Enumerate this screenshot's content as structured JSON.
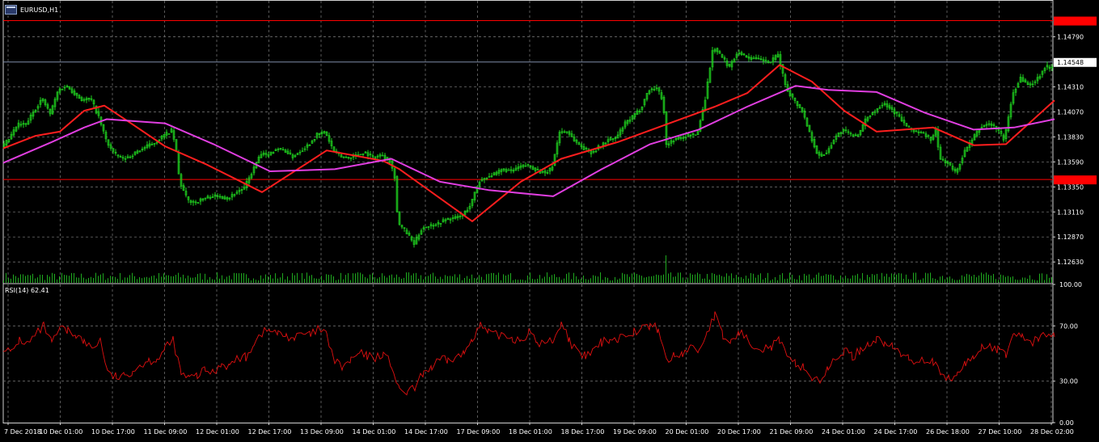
{
  "window": {
    "symbol_title": "EURUSD,H1"
  },
  "colors": {
    "background": "#000000",
    "grid": "#6e6e6e",
    "candle": "#1fd11f",
    "ma_fast": "#ff1e1e",
    "ma_slow": "#e03ee0",
    "level_line": "#ff0000",
    "bid_line": "#7d8aa5",
    "rsi": "#e01010",
    "volume": "#1fa81f"
  },
  "chart_data": [
    {
      "type": "line",
      "name": "price",
      "ylim": [
        1.1243,
        1.1505
      ],
      "y_ticks": [
        "1.14790",
        "1.14310",
        "1.14070",
        "1.13830",
        "1.13590",
        "1.13350",
        "1.13110",
        "1.12870",
        "1.12630"
      ],
      "price_badges": [
        {
          "label": "1.14548",
          "value": 1.14548,
          "style": "bid"
        }
      ],
      "levels": [
        {
          "value": 1.14945,
          "label": ""
        },
        {
          "value": 1.13421,
          "label": ""
        }
      ],
      "x_labels": [
        "7 Dec 2018",
        "10 Dec 01:00",
        "10 Dec 17:00",
        "11 Dec 09:00",
        "12 Dec 01:00",
        "12 Dec 17:00",
        "13 Dec 09:00",
        "14 Dec 01:00",
        "14 Dec 17:00",
        "17 Dec 09:00",
        "18 Dec 01:00",
        "18 Dec 17:00",
        "19 Dec 09:00",
        "20 Dec 01:00",
        "20 Dec 17:00",
        "21 Dec 09:00",
        "24 Dec 01:00",
        "24 Dec 17:00",
        "26 Dec 18:00",
        "27 Dec 10:00",
        "28 Dec 02:00"
      ],
      "closes": [
        [
          0,
          1.1372
        ],
        [
          10,
          1.1382
        ],
        [
          20,
          1.1395
        ],
        [
          30,
          1.1395
        ],
        [
          40,
          1.1408
        ],
        [
          50,
          1.142
        ],
        [
          60,
          1.1405
        ],
        [
          70,
          1.1428
        ],
        [
          80,
          1.1432
        ],
        [
          90,
          1.1425
        ],
        [
          100,
          1.1418
        ],
        [
          110,
          1.142
        ],
        [
          120,
          1.1402
        ],
        [
          130,
          1.1378
        ],
        [
          140,
          1.1366
        ],
        [
          150,
          1.1362
        ],
        [
          160,
          1.1365
        ],
        [
          170,
          1.137
        ],
        [
          180,
          1.1374
        ],
        [
          190,
          1.1378
        ],
        [
          200,
          1.1384
        ],
        [
          210,
          1.1389
        ],
        [
          215,
          1.1375
        ],
        [
          220,
          1.134
        ],
        [
          230,
          1.1322
        ],
        [
          240,
          1.132
        ],
        [
          250,
          1.1324
        ],
        [
          260,
          1.1326
        ],
        [
          270,
          1.1326
        ],
        [
          280,
          1.1324
        ],
        [
          290,
          1.133
        ],
        [
          300,
          1.1334
        ],
        [
          310,
          1.135
        ],
        [
          320,
          1.1366
        ],
        [
          330,
          1.1366
        ],
        [
          340,
          1.1372
        ],
        [
          350,
          1.137
        ],
        [
          360,
          1.1364
        ],
        [
          370,
          1.137
        ],
        [
          380,
          1.1376
        ],
        [
          390,
          1.1385
        ],
        [
          400,
          1.1388
        ],
        [
          410,
          1.137
        ],
        [
          420,
          1.1364
        ],
        [
          430,
          1.1363
        ],
        [
          440,
          1.1366
        ],
        [
          450,
          1.1368
        ],
        [
          460,
          1.1363
        ],
        [
          470,
          1.1366
        ],
        [
          480,
          1.136
        ],
        [
          486,
          1.1345
        ],
        [
          490,
          1.13
        ],
        [
          500,
          1.1292
        ],
        [
          510,
          1.128
        ],
        [
          520,
          1.1296
        ],
        [
          530,
          1.1298
        ],
        [
          540,
          1.13
        ],
        [
          550,
          1.1304
        ],
        [
          560,
          1.1305
        ],
        [
          570,
          1.1308
        ],
        [
          580,
          1.1318
        ],
        [
          590,
          1.134
        ],
        [
          600,
          1.1345
        ],
        [
          610,
          1.1347
        ],
        [
          620,
          1.1352
        ],
        [
          630,
          1.135
        ],
        [
          640,
          1.1354
        ],
        [
          650,
          1.1356
        ],
        [
          660,
          1.1352
        ],
        [
          670,
          1.1348
        ],
        [
          680,
          1.1352
        ],
        [
          690,
          1.1388
        ],
        [
          700,
          1.1388
        ],
        [
          710,
          1.1378
        ],
        [
          720,
          1.1372
        ],
        [
          730,
          1.1368
        ],
        [
          740,
          1.1374
        ],
        [
          750,
          1.138
        ],
        [
          760,
          1.1382
        ],
        [
          770,
          1.1395
        ],
        [
          780,
          1.1402
        ],
        [
          790,
          1.141
        ],
        [
          800,
          1.1428
        ],
        [
          810,
          1.143
        ],
        [
          818,
          1.1418
        ],
        [
          822,
          1.1375
        ],
        [
          830,
          1.138
        ],
        [
          840,
          1.1382
        ],
        [
          850,
          1.1385
        ],
        [
          860,
          1.1385
        ],
        [
          870,
          1.142
        ],
        [
          880,
          1.147
        ],
        [
          890,
          1.146
        ],
        [
          900,
          1.145
        ],
        [
          910,
          1.1465
        ],
        [
          920,
          1.146
        ],
        [
          930,
          1.1458
        ],
        [
          940,
          1.1457
        ],
        [
          950,
          1.1454
        ],
        [
          960,
          1.1462
        ],
        [
          970,
          1.143
        ],
        [
          980,
          1.1418
        ],
        [
          990,
          1.1408
        ],
        [
          1000,
          1.1385
        ],
        [
          1010,
          1.1364
        ],
        [
          1020,
          1.1368
        ],
        [
          1030,
          1.1382
        ],
        [
          1040,
          1.139
        ],
        [
          1050,
          1.1385
        ],
        [
          1060,
          1.1385
        ],
        [
          1070,
          1.1402
        ],
        [
          1080,
          1.1408
        ],
        [
          1090,
          1.1416
        ],
        [
          1100,
          1.141
        ],
        [
          1110,
          1.1402
        ],
        [
          1120,
          1.1392
        ],
        [
          1130,
          1.1388
        ],
        [
          1140,
          1.1386
        ],
        [
          1150,
          1.138
        ],
        [
          1155,
          1.139
        ],
        [
          1160,
          1.1362
        ],
        [
          1170,
          1.1358
        ],
        [
          1180,
          1.1348
        ],
        [
          1190,
          1.1368
        ],
        [
          1200,
          1.138
        ],
        [
          1210,
          1.1392
        ],
        [
          1220,
          1.1396
        ],
        [
          1230,
          1.1392
        ],
        [
          1240,
          1.138
        ],
        [
          1250,
          1.1424
        ],
        [
          1260,
          1.144
        ],
        [
          1270,
          1.1432
        ],
        [
          1280,
          1.1438
        ],
        [
          1290,
          1.145
        ],
        [
          1300,
          1.145
        ]
      ],
      "series": [
        {
          "key": "ma_fast",
          "points": [
            [
              0,
              1.1372
            ],
            [
              40,
              1.1384
            ],
            [
              70,
              1.1388
            ],
            [
              100,
              1.1408
            ],
            [
              125,
              1.1413
            ],
            [
              160,
              1.1395
            ],
            [
              200,
              1.1374
            ],
            [
              250,
              1.1357
            ],
            [
              320,
              1.133
            ],
            [
              400,
              1.137
            ],
            [
              470,
              1.136
            ],
            [
              490,
              1.1352
            ],
            [
              580,
              1.1302
            ],
            [
              640,
              1.134
            ],
            [
              690,
              1.1362
            ],
            [
              760,
              1.1378
            ],
            [
              820,
              1.1395
            ],
            [
              880,
              1.1412
            ],
            [
              920,
              1.1425
            ],
            [
              960,
              1.1452
            ],
            [
              1000,
              1.1436
            ],
            [
              1040,
              1.1408
            ],
            [
              1080,
              1.1388
            ],
            [
              1150,
              1.1392
            ],
            [
              1200,
              1.1375
            ],
            [
              1240,
              1.1376
            ],
            [
              1300,
              1.1418
            ]
          ]
        },
        {
          "key": "ma_slow",
          "points": [
            [
              0,
              1.1358
            ],
            [
              60,
              1.1378
            ],
            [
              100,
              1.1392
            ],
            [
              128,
              1.14
            ],
            [
              200,
              1.1396
            ],
            [
              260,
              1.1376
            ],
            [
              330,
              1.135
            ],
            [
              410,
              1.1352
            ],
            [
              480,
              1.1362
            ],
            [
              540,
              1.134
            ],
            [
              600,
              1.1332
            ],
            [
              680,
              1.1326
            ],
            [
              740,
              1.1352
            ],
            [
              800,
              1.1376
            ],
            [
              860,
              1.139
            ],
            [
              920,
              1.1412
            ],
            [
              980,
              1.1432
            ],
            [
              1020,
              1.1428
            ],
            [
              1080,
              1.1426
            ],
            [
              1140,
              1.1406
            ],
            [
              1200,
              1.139
            ],
            [
              1250,
              1.1392
            ],
            [
              1300,
              1.14
            ]
          ]
        }
      ],
      "volume_peak": {
        "index": 818
      }
    },
    {
      "type": "line",
      "name": "rsi",
      "title": "RSI(14) 62.41",
      "ylim": [
        0,
        100
      ],
      "y_ticks": [
        "100.00",
        "70.00",
        "30.00",
        "0.00"
      ],
      "levels": [
        70,
        30
      ],
      "values": [
        [
          0,
          55
        ],
        [
          10,
          50
        ],
        [
          20,
          60
        ],
        [
          30,
          57
        ],
        [
          40,
          63
        ],
        [
          50,
          70
        ],
        [
          60,
          57
        ],
        [
          70,
          68
        ],
        [
          80,
          66
        ],
        [
          90,
          64
        ],
        [
          100,
          58
        ],
        [
          110,
          54
        ],
        [
          120,
          60
        ],
        [
          130,
          35
        ],
        [
          140,
          33
        ],
        [
          150,
          33
        ],
        [
          160,
          38
        ],
        [
          170,
          42
        ],
        [
          180,
          45
        ],
        [
          190,
          46
        ],
        [
          200,
          53
        ],
        [
          210,
          60
        ],
        [
          220,
          35
        ],
        [
          230,
          32
        ],
        [
          240,
          34
        ],
        [
          250,
          38
        ],
        [
          260,
          36
        ],
        [
          270,
          43
        ],
        [
          280,
          41
        ],
        [
          290,
          47
        ],
        [
          300,
          47
        ],
        [
          310,
          58
        ],
        [
          320,
          65
        ],
        [
          330,
          67
        ],
        [
          340,
          64
        ],
        [
          350,
          63
        ],
        [
          360,
          61
        ],
        [
          370,
          64
        ],
        [
          380,
          63
        ],
        [
          390,
          68
        ],
        [
          400,
          63
        ],
        [
          410,
          44
        ],
        [
          420,
          40
        ],
        [
          430,
          45
        ],
        [
          440,
          50
        ],
        [
          450,
          48
        ],
        [
          460,
          47
        ],
        [
          470,
          50
        ],
        [
          480,
          42
        ],
        [
          490,
          22
        ],
        [
          500,
          22
        ],
        [
          510,
          25
        ],
        [
          520,
          37
        ],
        [
          530,
          40
        ],
        [
          540,
          45
        ],
        [
          550,
          45
        ],
        [
          560,
          47
        ],
        [
          570,
          50
        ],
        [
          580,
          62
        ],
        [
          590,
          70
        ],
        [
          600,
          65
        ],
        [
          610,
          63
        ],
        [
          620,
          64
        ],
        [
          630,
          61
        ],
        [
          640,
          60
        ],
        [
          650,
          65
        ],
        [
          660,
          58
        ],
        [
          670,
          57
        ],
        [
          680,
          60
        ],
        [
          690,
          72
        ],
        [
          700,
          60
        ],
        [
          710,
          50
        ],
        [
          720,
          48
        ],
        [
          730,
          52
        ],
        [
          740,
          58
        ],
        [
          750,
          61
        ],
        [
          760,
          60
        ],
        [
          770,
          65
        ],
        [
          780,
          66
        ],
        [
          790,
          68
        ],
        [
          800,
          70
        ],
        [
          810,
          68
        ],
        [
          820,
          45
        ],
        [
          830,
          48
        ],
        [
          840,
          50
        ],
        [
          850,
          55
        ],
        [
          860,
          52
        ],
        [
          870,
          65
        ],
        [
          880,
          78
        ],
        [
          890,
          62
        ],
        [
          900,
          58
        ],
        [
          910,
          66
        ],
        [
          920,
          60
        ],
        [
          930,
          56
        ],
        [
          940,
          54
        ],
        [
          950,
          55
        ],
        [
          960,
          60
        ],
        [
          970,
          45
        ],
        [
          980,
          43
        ],
        [
          990,
          40
        ],
        [
          1000,
          32
        ],
        [
          1010,
          31
        ],
        [
          1020,
          38
        ],
        [
          1030,
          47
        ],
        [
          1040,
          52
        ],
        [
          1050,
          48
        ],
        [
          1060,
          52
        ],
        [
          1070,
          58
        ],
        [
          1080,
          60
        ],
        [
          1090,
          58
        ],
        [
          1100,
          54
        ],
        [
          1110,
          50
        ],
        [
          1120,
          46
        ],
        [
          1130,
          45
        ],
        [
          1140,
          46
        ],
        [
          1150,
          44
        ],
        [
          1160,
          33
        ],
        [
          1170,
          31
        ],
        [
          1180,
          35
        ],
        [
          1190,
          43
        ],
        [
          1200,
          47
        ],
        [
          1210,
          55
        ],
        [
          1220,
          56
        ],
        [
          1230,
          52
        ],
        [
          1240,
          50
        ],
        [
          1250,
          65
        ],
        [
          1260,
          62
        ],
        [
          1270,
          58
        ],
        [
          1280,
          60
        ],
        [
          1290,
          65
        ],
        [
          1300,
          62
        ]
      ]
    }
  ]
}
